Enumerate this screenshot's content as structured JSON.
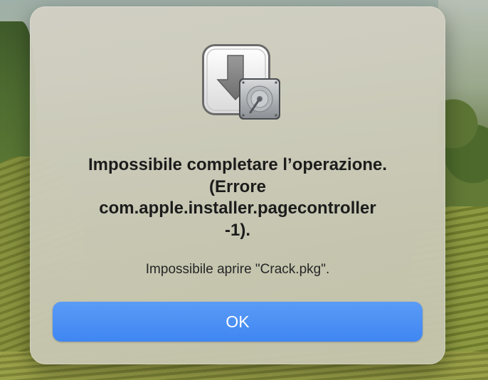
{
  "dialog": {
    "icon": "installer-disk-icon",
    "title": "Impossibile completare l’operazione.\n(Errore\ncom.apple.installer.pagecontroller\n-1).",
    "message": "Impossibile aprire \"Crack.pkg\".",
    "ok_label": "OK"
  },
  "colors": {
    "button_accent": "#3f86f2",
    "dialog_background": "#cccbba",
    "title_text": "#1c1c1c"
  }
}
